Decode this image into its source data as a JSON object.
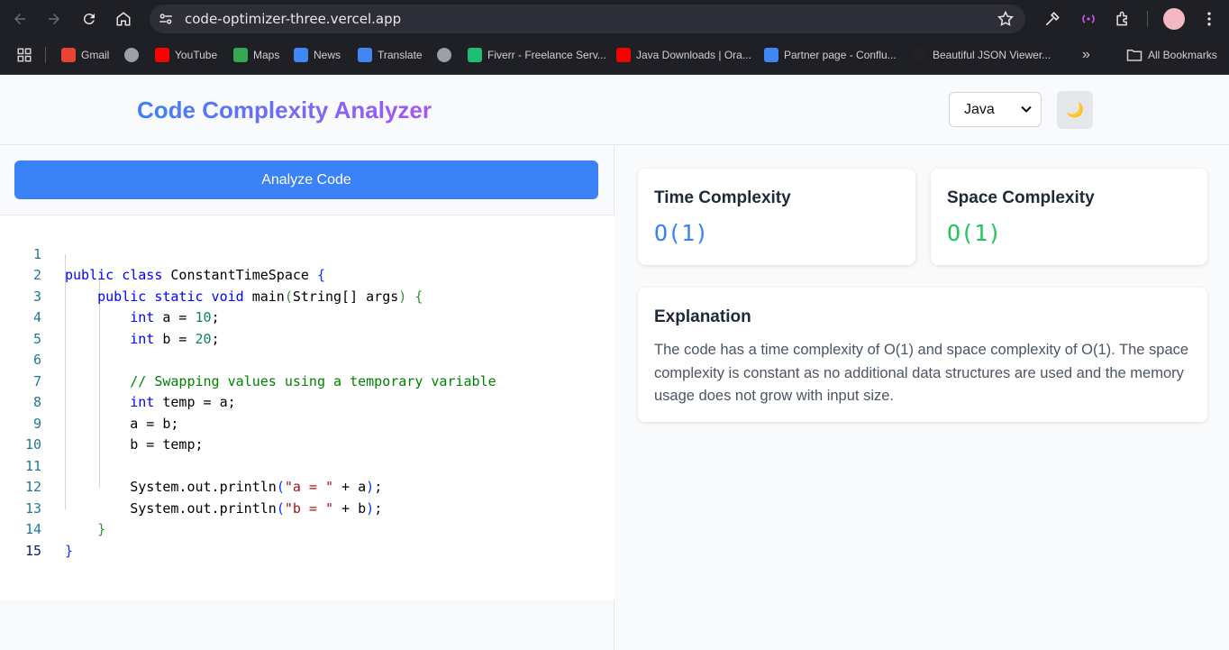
{
  "browser": {
    "url": "code-optimizer-three.vercel.app",
    "bookmarks": [
      {
        "label": "Gmail",
        "icon": "gmail-icon",
        "color": "#ea4335"
      },
      {
        "label": "",
        "icon": "globe-icon",
        "color": "#9aa0a6"
      },
      {
        "label": "YouTube",
        "icon": "youtube-icon",
        "color": "#ff0000"
      },
      {
        "label": "Maps",
        "icon": "maps-icon",
        "color": "#34a853"
      },
      {
        "label": "News",
        "icon": "news-icon",
        "color": "#4285f4"
      },
      {
        "label": "Translate",
        "icon": "translate-icon",
        "color": "#4285f4"
      },
      {
        "label": "",
        "icon": "globe-icon",
        "color": "#9aa0a6"
      },
      {
        "label": "Fiverr - Freelance Serv...",
        "icon": "fiverr-icon",
        "color": "#1dbf73"
      },
      {
        "label": "Java Downloads | Ora...",
        "icon": "oracle-icon",
        "color": "#f80000"
      },
      {
        "label": "Partner page - Conflu...",
        "icon": "google-icon",
        "color": "#4285f4"
      },
      {
        "label": "Beautiful JSON Viewer...",
        "icon": "json-viewer-icon",
        "color": "#222222"
      }
    ],
    "more_label": "»",
    "all_bookmarks_label": "All Bookmarks"
  },
  "app": {
    "title": "Code Complexity Analyzer",
    "language_selected": "Java",
    "theme_toggle_icon": "🌙",
    "analyze_label": "Analyze Code"
  },
  "editor": {
    "line_numbers": [
      "1",
      "2",
      "3",
      "4",
      "5",
      "6",
      "7",
      "8",
      "9",
      "10",
      "11",
      "12",
      "13",
      "14",
      "15"
    ],
    "active_line": 15
  },
  "results": {
    "time_title": "Time Complexity",
    "time_value": "O(1)",
    "space_title": "Space Complexity",
    "space_value": "O(1)",
    "explanation_title": "Explanation",
    "explanation_text": "The code has a time complexity of O(1) and space complexity of O(1). The space complexity is constant as no additional data structures are used and the memory usage does not grow with input size.",
    "colors": {
      "time": "#3b82f6",
      "space": "#22c55e"
    }
  }
}
